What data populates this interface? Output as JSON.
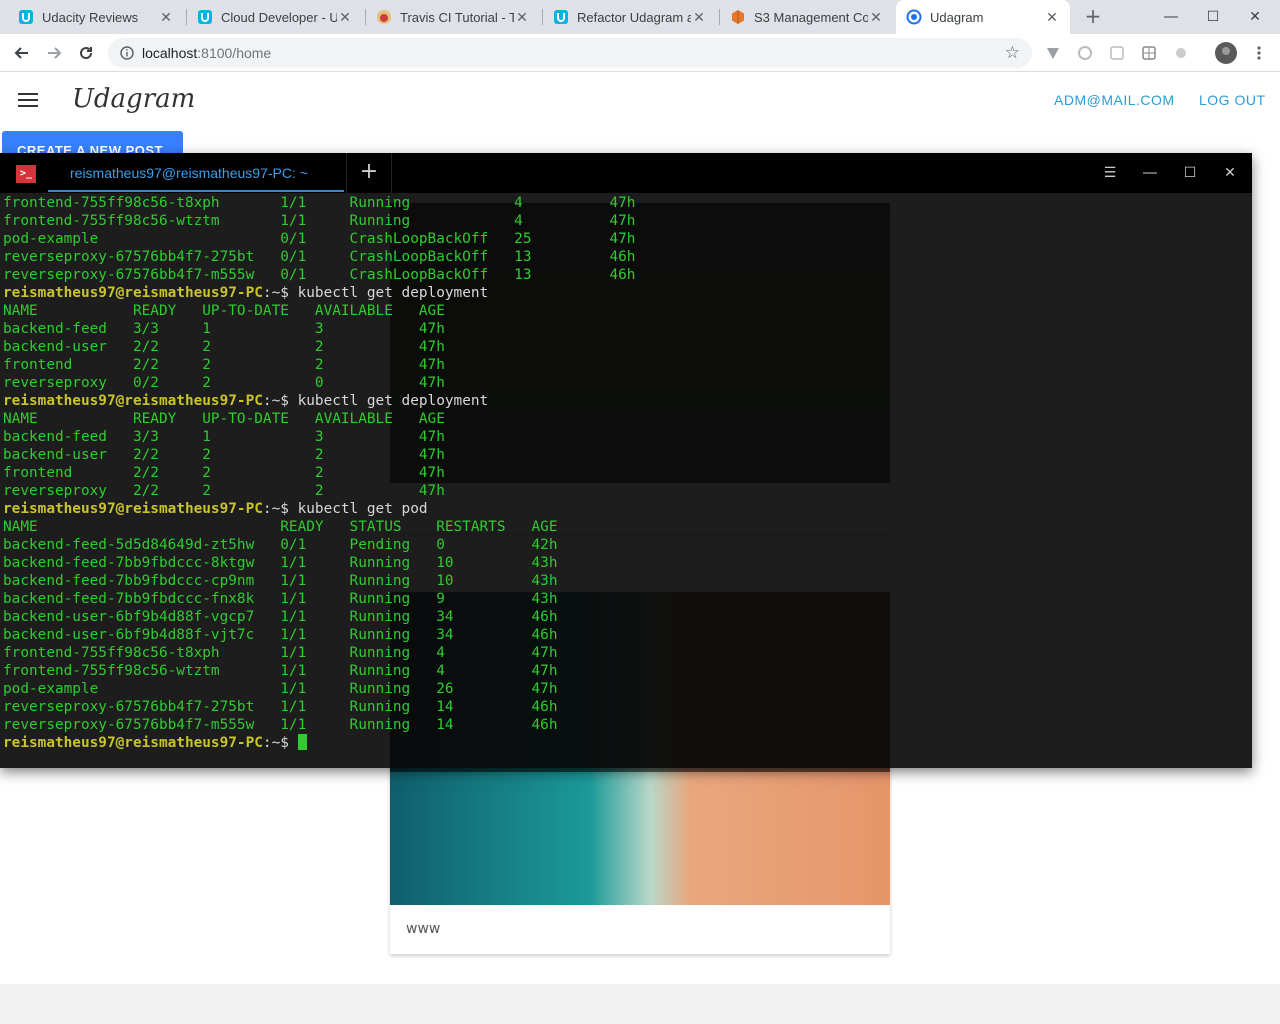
{
  "browser": {
    "tabs": [
      {
        "title": "Udacity Reviews",
        "icon": "udacity-icon"
      },
      {
        "title": "Cloud Developer - U",
        "icon": "udacity-icon"
      },
      {
        "title": "Travis CI Tutorial - Tr",
        "icon": "travis-icon"
      },
      {
        "title": "Refactor Udagram a",
        "icon": "udacity-icon"
      },
      {
        "title": "S3 Management Co",
        "icon": "aws-icon"
      },
      {
        "title": "Udagram",
        "icon": "globe-icon",
        "active": true
      }
    ],
    "url_host": "localhost",
    "url_path": ":8100/home"
  },
  "app": {
    "brand": "Udagram",
    "user_email": "ADM@MAIL.COM",
    "logout_label": "LOG OUT",
    "create_post_label": "CREATE A NEW POST",
    "posts": [
      {
        "caption": ""
      },
      {
        "caption": "www"
      }
    ]
  },
  "terminal": {
    "tab_title": "reismatheus97@reismatheus97-PC: ~",
    "prompt_user": "reismatheus97@reismatheus97-PC",
    "prompt_sym": ":~$ ",
    "lines": [
      {
        "t": "o",
        "text": "frontend-755ff98c56-t8xph       1/1     Running            4          47h"
      },
      {
        "t": "o",
        "text": "frontend-755ff98c56-wtztm       1/1     Running            4          47h"
      },
      {
        "t": "o",
        "text": "pod-example                     0/1     CrashLoopBackOff   25         47h"
      },
      {
        "t": "o",
        "text": "reverseproxy-67576bb4f7-275bt   0/1     CrashLoopBackOff   13         46h"
      },
      {
        "t": "o",
        "text": "reverseproxy-67576bb4f7-m555w   0/1     CrashLoopBackOff   13         46h"
      },
      {
        "t": "p",
        "text": "kubectl get deployment"
      },
      {
        "t": "o",
        "text": "NAME           READY   UP-TO-DATE   AVAILABLE   AGE"
      },
      {
        "t": "o",
        "text": "backend-feed   3/3     1            3           47h"
      },
      {
        "t": "o",
        "text": "backend-user   2/2     2            2           47h"
      },
      {
        "t": "o",
        "text": "frontend       2/2     2            2           47h"
      },
      {
        "t": "o",
        "text": "reverseproxy   0/2     2            0           47h"
      },
      {
        "t": "p",
        "text": "kubectl get deployment"
      },
      {
        "t": "o",
        "text": "NAME           READY   UP-TO-DATE   AVAILABLE   AGE"
      },
      {
        "t": "o",
        "text": "backend-feed   3/3     1            3           47h"
      },
      {
        "t": "o",
        "text": "backend-user   2/2     2            2           47h"
      },
      {
        "t": "o",
        "text": "frontend       2/2     2            2           47h"
      },
      {
        "t": "o",
        "text": "reverseproxy   2/2     2            2           47h"
      },
      {
        "t": "p",
        "text": "kubectl get pod"
      },
      {
        "t": "o",
        "text": "NAME                            READY   STATUS    RESTARTS   AGE"
      },
      {
        "t": "o",
        "text": "backend-feed-5d5d84649d-zt5hw   0/1     Pending   0          42h"
      },
      {
        "t": "o",
        "text": "backend-feed-7bb9fbdccc-8ktgw   1/1     Running   10         43h"
      },
      {
        "t": "o",
        "text": "backend-feed-7bb9fbdccc-cp9nm   1/1     Running   10         43h"
      },
      {
        "t": "o",
        "text": "backend-feed-7bb9fbdccc-fnx8k   1/1     Running   9          43h"
      },
      {
        "t": "o",
        "text": "backend-user-6bf9b4d88f-vgcp7   1/1     Running   34         46h"
      },
      {
        "t": "o",
        "text": "backend-user-6bf9b4d88f-vjt7c   1/1     Running   34         46h"
      },
      {
        "t": "o",
        "text": "frontend-755ff98c56-t8xph       1/1     Running   4          47h"
      },
      {
        "t": "o",
        "text": "frontend-755ff98c56-wtztm       1/1     Running   4          47h"
      },
      {
        "t": "o",
        "text": "pod-example                     1/1     Running   26         47h"
      },
      {
        "t": "o",
        "text": "reverseproxy-67576bb4f7-275bt   1/1     Running   14         46h"
      },
      {
        "t": "o",
        "text": "reverseproxy-67576bb4f7-m555w   1/1     Running   14         46h"
      },
      {
        "t": "c",
        "text": ""
      }
    ]
  },
  "colors": {
    "accent": "#3880ff",
    "link": "#2d9bd6",
    "terminal_text": "#2ecc2e",
    "prompt": "#c8c42b"
  }
}
